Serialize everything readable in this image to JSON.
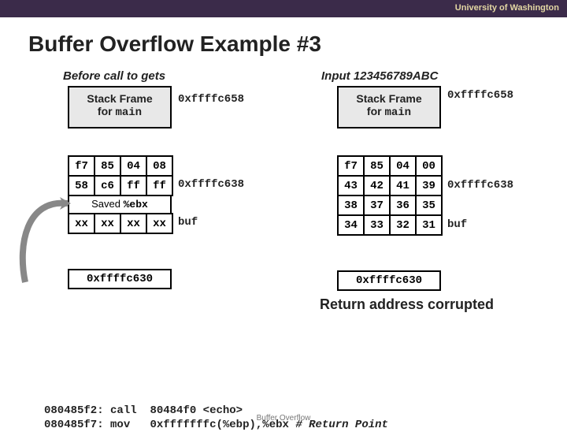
{
  "header": {
    "univ": "University of Washington"
  },
  "title": "Buffer Overflow Example #3",
  "left": {
    "subtitle": "Before call to gets",
    "frame_line1": "Stack Frame",
    "frame_line2_prefix": "for ",
    "frame_line2_mono": "main",
    "addr_top": "0xffffc658",
    "row0": [
      "f7",
      "85",
      "04",
      "08"
    ],
    "row1": [
      "58",
      "c6",
      "ff",
      "ff"
    ],
    "saved_prefix": "Saved ",
    "saved_mono": "%ebx",
    "row2": [
      "xx",
      "xx",
      "xx",
      "xx"
    ],
    "addr_mid": "0xffffc638",
    "label_buf": "buf",
    "bottom": "0xffffc630"
  },
  "right": {
    "subtitle": "Input 123456789ABC",
    "frame_line1": "Stack Frame",
    "frame_line2_prefix": "for ",
    "frame_line2_mono": "main",
    "addr_top": "0xffffc658",
    "row0": [
      "f7",
      "85",
      "04",
      "00"
    ],
    "row1": [
      "43",
      "42",
      "41",
      "39"
    ],
    "row2": [
      "38",
      "37",
      "36",
      "35"
    ],
    "row3": [
      "34",
      "33",
      "32",
      "31"
    ],
    "addr_mid": "0xffffc638",
    "label_buf": "buf",
    "bottom": "0xffffc630",
    "corrupt": "Return address corrupted"
  },
  "code": {
    "l1_addr": "080485f2:",
    "l1_op": "call",
    "l1_arg": "80484f0 <echo>",
    "l2_addr": "080485f7:",
    "l2_op": "mov",
    "l2_arg": "0xfffffffc(%ebp),%ebx",
    "l2_comment": "# Return Point"
  },
  "footer": "Buffer Overflow"
}
